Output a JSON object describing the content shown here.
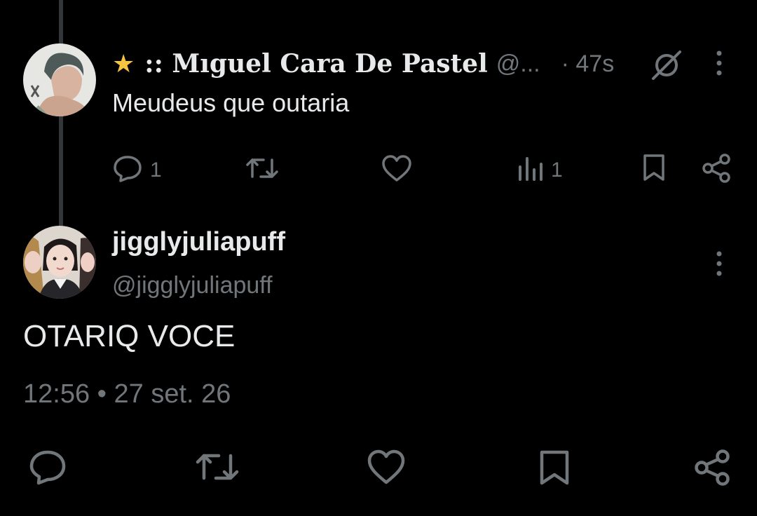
{
  "reply": {
    "display_name": ":: Mıguel Cara De Pastel",
    "handle": "@...",
    "time": "· 47s",
    "text": "Meudeus que outaria",
    "reply_count": "1",
    "views_count": "1"
  },
  "main": {
    "display_name": "jigglyjuliapuff",
    "handle": "@jigglyjuliapuff",
    "text": "OTARIQ VOCE",
    "timestamp": "12:56 • 27 set. 26"
  },
  "colors": {
    "background": "#000000",
    "text": "#e7e9ea",
    "muted": "#71767b",
    "thread_line": "#333639",
    "star": "#f5c542"
  },
  "icons": [
    "star-icon",
    "muted-icon",
    "more-icon",
    "reply-icon",
    "retweet-icon",
    "like-icon",
    "views-icon",
    "bookmark-icon",
    "share-icon"
  ]
}
